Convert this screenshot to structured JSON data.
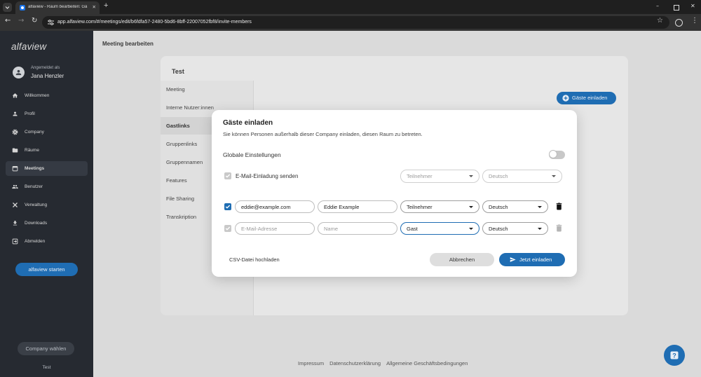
{
  "browser": {
    "tab_title": "alfaview - Raum bearbeiten: Gä",
    "url": "app.alfaview.com/#/meetings/edit/b6fdfa57-2480-5bd6-8bff-22007052fbf8/invite-members"
  },
  "sidebar": {
    "logo": "alfaview",
    "logged_in_label": "Angemeldet als",
    "user_name": "Jana Henzler",
    "items": [
      {
        "label": "Willkommen",
        "icon": "home-icon"
      },
      {
        "label": "Profil",
        "icon": "person-icon"
      },
      {
        "label": "Company",
        "icon": "gear-icon"
      },
      {
        "label": "Räume",
        "icon": "folder-icon"
      },
      {
        "label": "Meetings",
        "icon": "calendar-icon",
        "active": true
      },
      {
        "label": "Benutzer",
        "icon": "group-icon"
      },
      {
        "label": "Verwaltung",
        "icon": "tools-icon"
      },
      {
        "label": "Downloads",
        "icon": "download-icon"
      },
      {
        "label": "Abmelden",
        "icon": "logout-icon"
      }
    ],
    "start_button": "alfaview starten",
    "company_button": "Company wählen",
    "company_name": "Test"
  },
  "header": {
    "title": "Meeting bearbeiten"
  },
  "room": {
    "title": "Test",
    "nav": [
      {
        "label": "Meeting"
      },
      {
        "label": "Interne Nutzer:innen"
      },
      {
        "label": "Gastlinks",
        "active": true
      },
      {
        "label": "Gruppenlinks"
      },
      {
        "label": "Gruppennamen"
      },
      {
        "label": "Features"
      },
      {
        "label": "File Sharing"
      },
      {
        "label": "Transkription"
      }
    ],
    "invite_button": "Gäste einladen"
  },
  "modal": {
    "title": "Gäste einladen",
    "subtitle": "Sie können Personen außerhalb dieser Company einladen, diesen Raum zu betreten.",
    "global_settings": {
      "label": "Globale Einstellungen",
      "enabled": false
    },
    "email_invite": {
      "label": "E-Mail-Einladung senden",
      "checked": true,
      "role": "Teilnehmer",
      "language": "Deutsch"
    },
    "guests": [
      {
        "checked": true,
        "email": "eddie@example.com",
        "name": "Eddie Example",
        "role": "Teilnehmer",
        "language": "Deutsch"
      },
      {
        "checked": true,
        "email_placeholder": "E-Mail-Adresse",
        "name_placeholder": "Name",
        "role": "Gast",
        "language": "Deutsch"
      }
    ],
    "csv_upload": "CSV-Datei hochladen",
    "cancel_button": "Abbrechen",
    "submit_button": "Jetzt einladen"
  },
  "footer": {
    "links": [
      "Impressum",
      "Datenschutzerklärung",
      "Allgemeine Geschäftsbedingungen"
    ]
  },
  "colors": {
    "accent": "#1f6db3",
    "sidebar_bg": "#262a31",
    "modal_bg": "#ffffff"
  }
}
